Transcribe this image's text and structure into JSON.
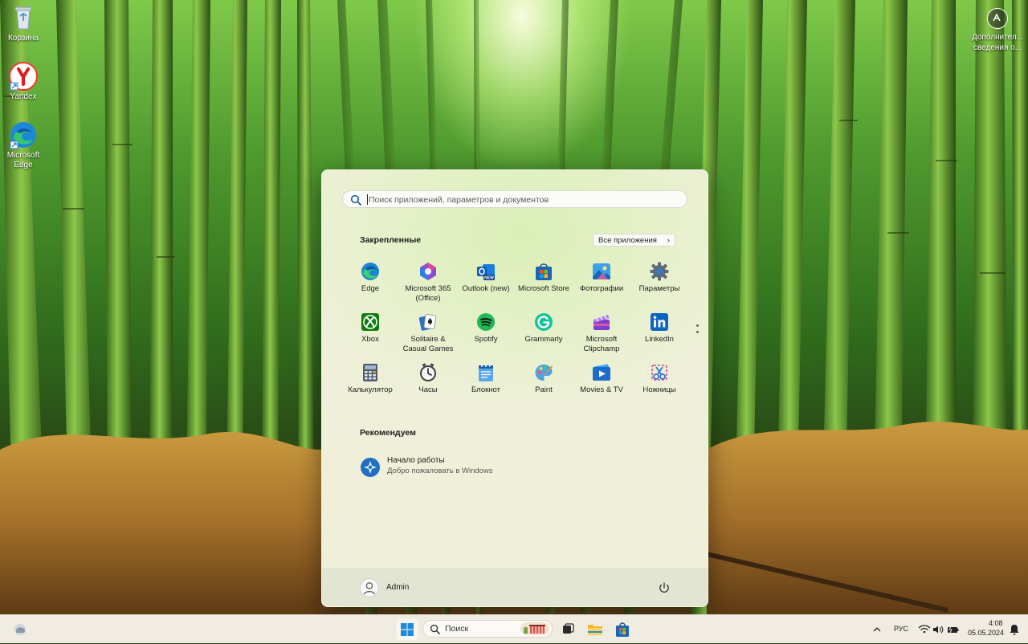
{
  "desktop": {
    "icons": [
      {
        "label": "Корзина"
      },
      {
        "label": "Yandex"
      },
      {
        "label": "Microsoft Edge"
      }
    ],
    "picture_info": {
      "line1": "Дополнител...",
      "line2": "сведения о..."
    }
  },
  "start_menu": {
    "search": {
      "placeholder": "Поиск приложений, параметров и документов"
    },
    "pinned": {
      "title": "Закрепленные",
      "all_apps_label": "Все приложения",
      "apps": [
        {
          "label": "Edge",
          "icon": "edge-icon"
        },
        {
          "label": "Microsoft 365 (Office)",
          "icon": "microsoft-365-icon"
        },
        {
          "label": "Outlook (new)",
          "icon": "outlook-icon"
        },
        {
          "label": "Microsoft Store",
          "icon": "store-icon"
        },
        {
          "label": "Фотографии",
          "icon": "photos-icon"
        },
        {
          "label": "Параметры",
          "icon": "settings-gear-icon"
        },
        {
          "label": "Xbox",
          "icon": "xbox-icon"
        },
        {
          "label": "Solitaire & Casual Games",
          "icon": "solitaire-icon"
        },
        {
          "label": "Spotify",
          "icon": "spotify-icon"
        },
        {
          "label": "Grammarly",
          "icon": "grammarly-icon"
        },
        {
          "label": "Microsoft Clipchamp",
          "icon": "clipchamp-icon"
        },
        {
          "label": "LinkedIn",
          "icon": "linkedin-icon"
        },
        {
          "label": "Калькулятор",
          "icon": "calculator-icon"
        },
        {
          "label": "Часы",
          "icon": "clock-icon"
        },
        {
          "label": "Блокнот",
          "icon": "notepad-icon"
        },
        {
          "label": "Paint",
          "icon": "paint-icon"
        },
        {
          "label": "Movies & TV",
          "icon": "movies-tv-icon"
        },
        {
          "label": "Ножницы",
          "icon": "snipping-tool-icon"
        }
      ]
    },
    "recommended": {
      "title": "Рекомендуем",
      "items": [
        {
          "title": "Начало работы",
          "subtitle": "Добро пожаловать в Windows"
        }
      ]
    },
    "footer": {
      "user_name": "Admin"
    }
  },
  "taskbar": {
    "search_label": "Поиск",
    "tray": {
      "language": "РУС",
      "time": "4:08",
      "date": "05.05.2024"
    }
  },
  "colors": {
    "accent": "#0067c0",
    "taskbar_bg": "#f1ece2"
  }
}
